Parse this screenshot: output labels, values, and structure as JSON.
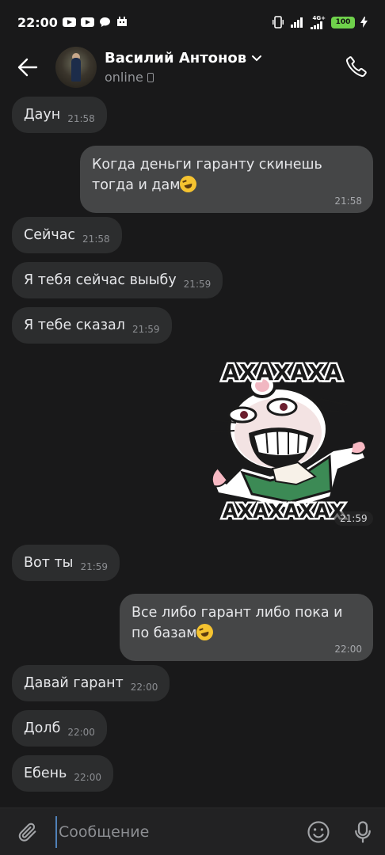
{
  "status_bar": {
    "time": "22:00",
    "network": "4G+",
    "battery": "100"
  },
  "header": {
    "back_icon": "arrow-left-icon",
    "contact_name": "Василий Антонов",
    "contact_status": "online",
    "call_icon": "phone-icon"
  },
  "messages": [
    {
      "dir": "in",
      "text": "Даун",
      "time": "21:58"
    },
    {
      "dir": "out",
      "text": "Когда деньги гаранту скинешь тогда и дам",
      "emoji": "rofl",
      "time": "21:58"
    },
    {
      "dir": "in",
      "text": "Сейчас",
      "time": "21:58"
    },
    {
      "dir": "in",
      "text": "Я тебя сейчас выыбу",
      "time": "21:59"
    },
    {
      "dir": "in",
      "text": "Я тебе сказал",
      "time": "21:59"
    },
    {
      "dir": "out",
      "type": "sticker",
      "sticker_text_top": "АХАХАХА",
      "sticker_text_bottom": "АХАХАХАХ",
      "time": "21:59"
    },
    {
      "dir": "in",
      "text": "Вот ты",
      "time": "21:59"
    },
    {
      "dir": "out",
      "text": "Все либо гарант либо пока и по базам",
      "emoji": "rofl",
      "time": "22:00"
    },
    {
      "dir": "in",
      "text": "Давай гарант",
      "time": "22:00"
    },
    {
      "dir": "in",
      "text": "Долб",
      "time": "22:00"
    },
    {
      "dir": "in",
      "text": "Ебень",
      "time": "22:00"
    }
  ],
  "composer": {
    "placeholder": "Сообщение",
    "attach_icon": "paperclip-icon",
    "emoji_icon": "smiley-icon",
    "mic_icon": "microphone-icon"
  },
  "colors": {
    "background": "#19191a",
    "incoming_bubble": "#2c2d2e",
    "outgoing_bubble": "#454647",
    "accent": "#5181b8",
    "battery": "#6fd14b"
  }
}
